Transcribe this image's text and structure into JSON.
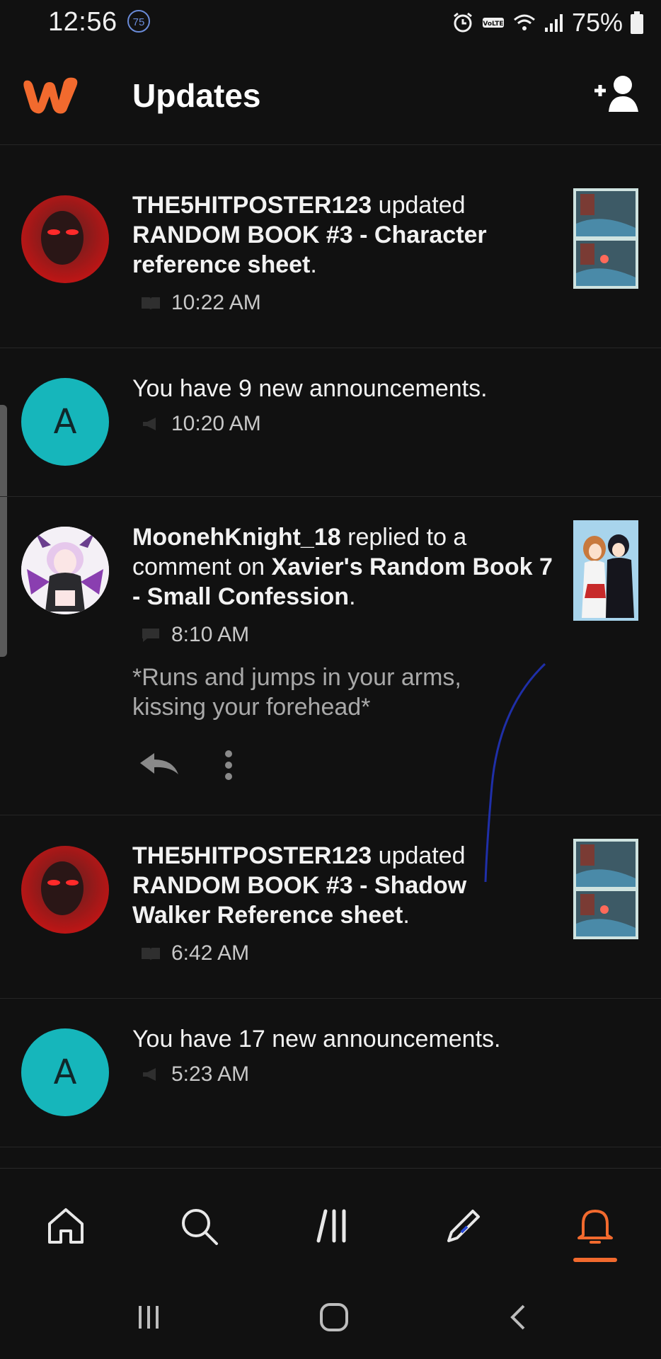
{
  "status_bar": {
    "time": "12:56",
    "badge": "75",
    "battery": "75%",
    "icons": [
      "alarm-icon",
      "volte-icon",
      "wifi-icon",
      "signal-icon",
      "battery-icon"
    ]
  },
  "app_bar": {
    "title": "Updates",
    "logo": "wattpad-logo",
    "action_icon": "add-user-icon"
  },
  "feed": [
    {
      "type": "story-update",
      "avatar_icon": "user-avatar-red-eyes",
      "user": "THE5HITPOSTER123",
      "verb": " updated ",
      "target": "RANDOM BOOK #3 - Character reference sheet",
      "suffix": ".",
      "time": "10:22 AM",
      "meta_icon": "book-icon",
      "thumb": "story-thumbnail"
    },
    {
      "type": "announcement",
      "avatar_letter": "A",
      "text": "You have 9 new announcements.",
      "time": "10:20 AM",
      "meta_icon": "megaphone-icon"
    },
    {
      "type": "comment-reply",
      "avatar_icon": "user-avatar-anime",
      "user": "MoonehKnight_18",
      "verb": " replied to a comment on ",
      "target": "Xavier's Random Book 7 - Small Confession",
      "suffix": ".",
      "time": "8:10 AM",
      "meta_icon": "comment-icon",
      "excerpt": "*Runs and jumps in your arms, kissing your forehead*",
      "thumb": "story-cover-thumbnail"
    },
    {
      "type": "story-update",
      "avatar_icon": "user-avatar-red-eyes",
      "user": "THE5HITPOSTER123",
      "verb": " updated ",
      "target": "RANDOM BOOK #3 - Shadow Walker Reference sheet",
      "suffix": ".",
      "time": "6:42 AM",
      "meta_icon": "book-icon",
      "thumb": "story-thumbnail"
    },
    {
      "type": "announcement",
      "avatar_letter": "A",
      "text": "You have 17 new announcements.",
      "time": "5:23 AM",
      "meta_icon": "megaphone-icon"
    }
  ],
  "bottom_nav": {
    "items": [
      "home-icon",
      "search-icon",
      "library-icon",
      "write-icon",
      "notifications-icon"
    ],
    "active": "notifications-icon"
  },
  "system_nav": [
    "recents-icon",
    "home-button-icon",
    "back-icon"
  ],
  "colors": {
    "background": "#111111",
    "accent": "#f26a2e",
    "announcement_avatar": "#16b6bb",
    "muted_text": "#a9a9a9"
  }
}
